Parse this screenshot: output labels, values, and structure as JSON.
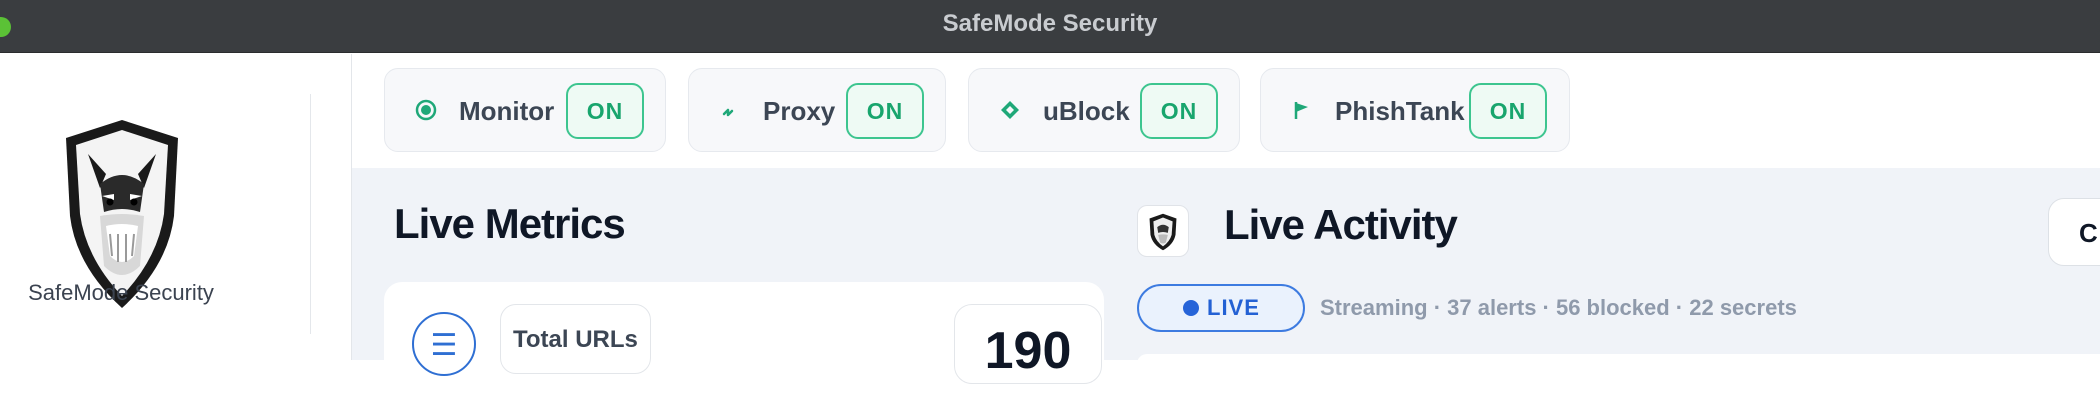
{
  "window": {
    "title": "SafeMode Security"
  },
  "sidebar": {
    "brand": "SafeMode Security",
    "logo_icon": "schnauzer-shield-logo"
  },
  "toggles": [
    {
      "label": "Monitor",
      "icon": "radio-dot-icon",
      "state": "ON"
    },
    {
      "label": "Proxy",
      "icon": "plug-icon",
      "state": "ON"
    },
    {
      "label": "uBlock",
      "icon": "diamond-icon",
      "state": "ON"
    },
    {
      "label": "PhishTank",
      "icon": "flag-icon",
      "state": "ON"
    }
  ],
  "metrics": {
    "heading": "Live Metrics",
    "card": {
      "label": "Total URLs",
      "value": "190",
      "icon": "list-icon"
    }
  },
  "activity": {
    "heading": "Live Activity",
    "live_label": "LIVE",
    "status_line": "Streaming · 37 alerts · 56 blocked · 22 secrets",
    "right_button_label": "C"
  },
  "colors": {
    "accent_green": "#1fa878",
    "live_blue": "#2664d8",
    "titlebar": "#3a3d40"
  }
}
